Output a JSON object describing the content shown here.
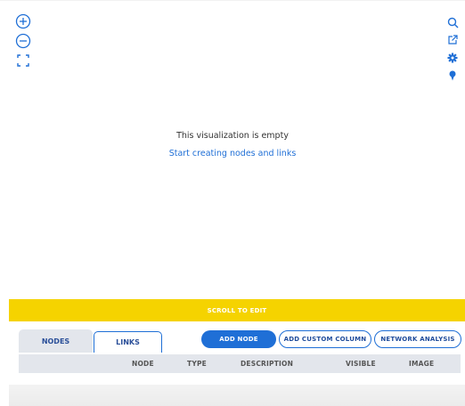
{
  "canvas": {
    "empty_title": "This visualization is empty",
    "empty_link": "Start creating nodes and links"
  },
  "toolbar_left": {
    "icons": [
      "zoom-in-icon",
      "zoom-out-icon",
      "fit-screen-icon"
    ]
  },
  "toolbar_right": {
    "icons": [
      "search-icon",
      "share-icon",
      "settings-gear-icon",
      "map-pin-icon"
    ]
  },
  "scroll_banner": {
    "label": "SCROLL TO EDIT"
  },
  "tabs": [
    {
      "label": "NODES",
      "active": true
    },
    {
      "label": "LINKS",
      "active": false
    }
  ],
  "actions": {
    "add_node": "ADD NODE",
    "add_custom_column": "ADD CUSTOM COLUMN",
    "network_analysis": "NETWORK ANALYSIS"
  },
  "table": {
    "columns": [
      "NODE",
      "TYPE",
      "DESCRIPTION",
      "VISIBLE",
      "IMAGE"
    ]
  },
  "colors": {
    "accent": "#1f6fd6",
    "banner": "#f5d300",
    "header_bg": "#e3e6ec"
  }
}
